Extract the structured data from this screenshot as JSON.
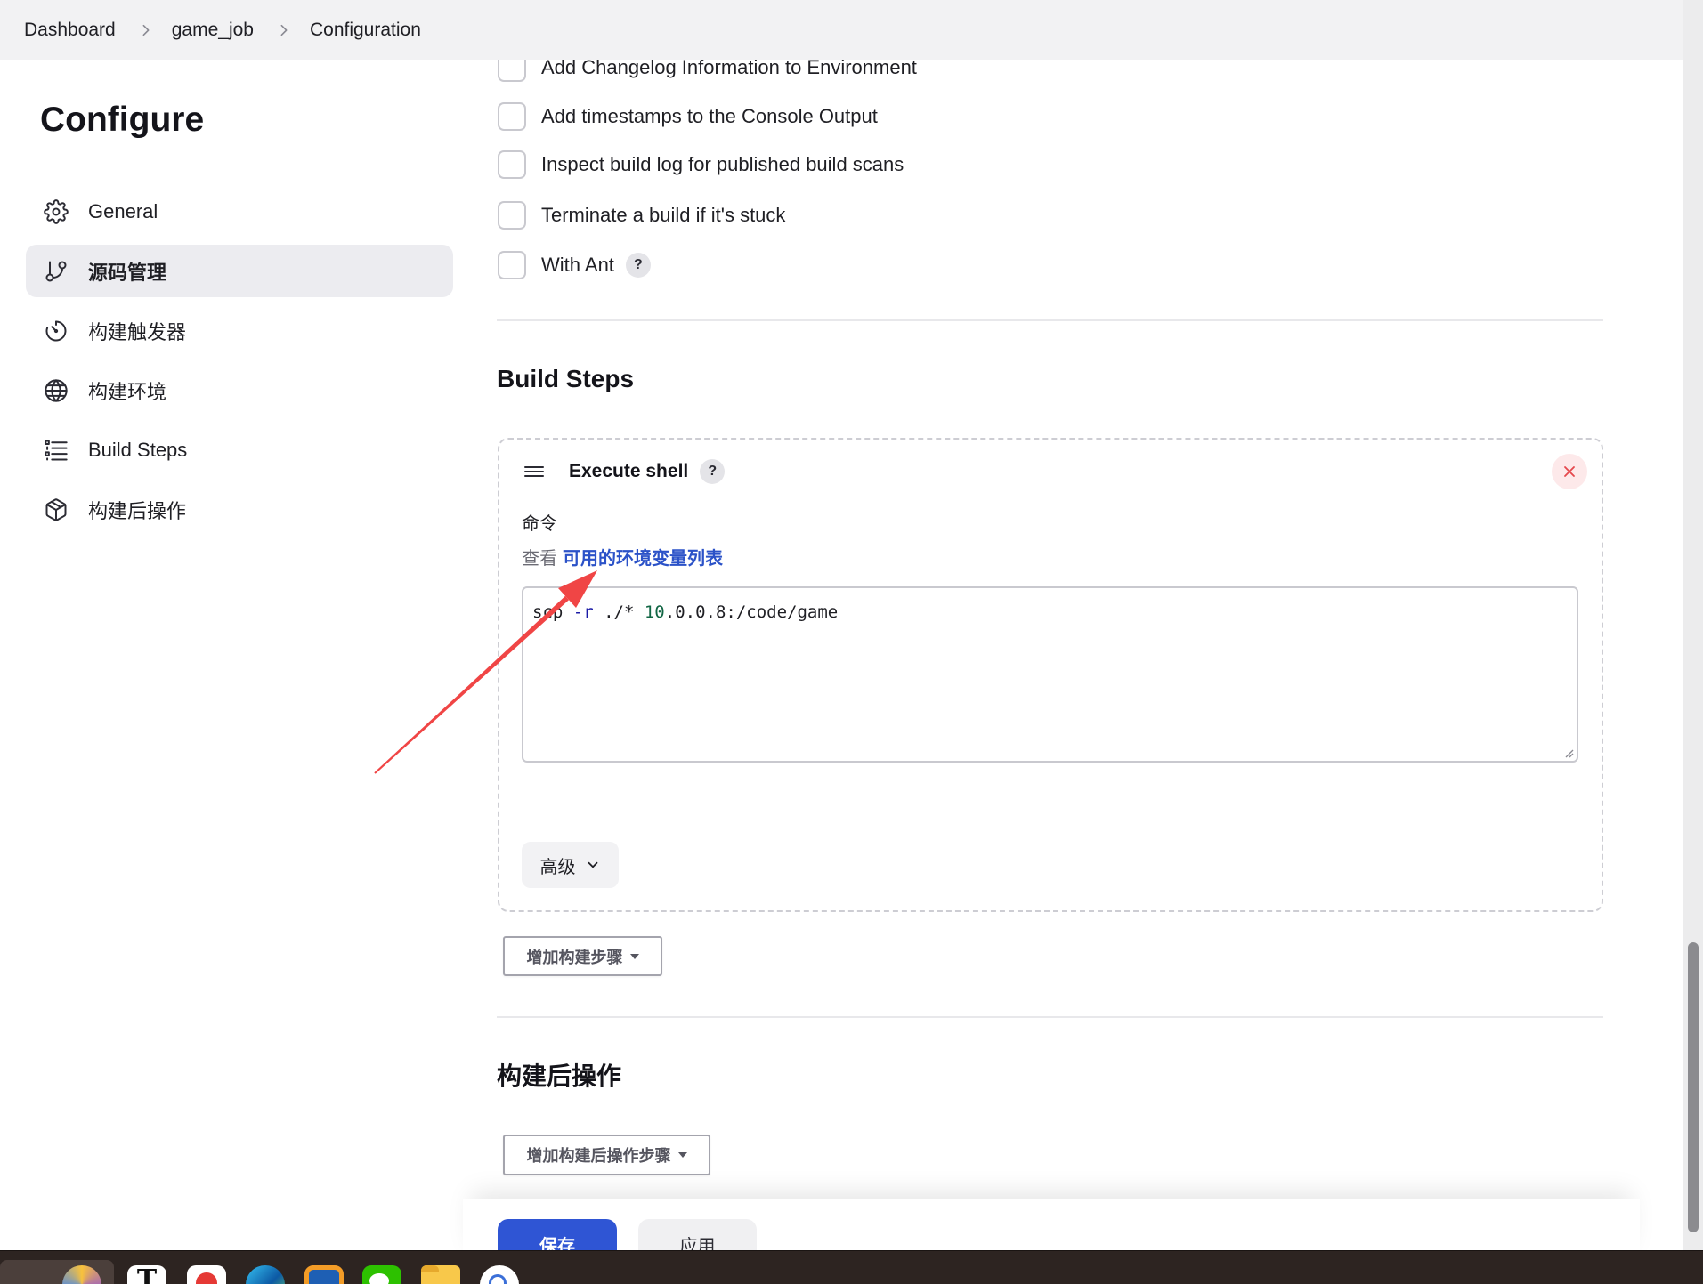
{
  "breadcrumb": {
    "items": [
      "Dashboard",
      "game_job",
      "Configuration"
    ]
  },
  "sidebar": {
    "title": "Configure",
    "items": [
      {
        "label": "General",
        "icon": "gear-icon",
        "active": false
      },
      {
        "label": "源码管理",
        "icon": "git-branch-icon",
        "active": true
      },
      {
        "label": "构建触发器",
        "icon": "timer-icon",
        "active": false
      },
      {
        "label": "构建环境",
        "icon": "globe-icon",
        "active": false
      },
      {
        "label": "Build Steps",
        "icon": "list-icon",
        "active": false
      },
      {
        "label": "构建后操作",
        "icon": "package-icon",
        "active": false
      }
    ]
  },
  "build_environment": {
    "options": [
      {
        "label": "Add Changelog Information to Environment",
        "checked": false
      },
      {
        "label": "Add timestamps to the Console Output",
        "checked": false
      },
      {
        "label": "Inspect build log for published build scans",
        "checked": false
      },
      {
        "label": "Terminate a build if it's stuck",
        "checked": false
      },
      {
        "label": "With Ant",
        "checked": false,
        "help": "?"
      }
    ]
  },
  "build_steps": {
    "heading": "Build Steps",
    "step": {
      "title": "Execute shell",
      "help": "?",
      "command_label": "命令",
      "env_hint_prefix": "查看",
      "env_link": "可用的环境变量列表",
      "command_tokens": [
        {
          "text": "scp ",
          "kind": "plain"
        },
        {
          "text": "-r",
          "kind": "attribute"
        },
        {
          "text": " ./* ",
          "kind": "plain"
        },
        {
          "text": "10",
          "kind": "number"
        },
        {
          "text": ".0.0.8:/code/game",
          "kind": "plain"
        }
      ],
      "advanced_label": "高级"
    },
    "add_step_label": "增加构建步骤"
  },
  "post_build": {
    "heading": "构建后操作",
    "add_label": "增加构建后操作步骤"
  },
  "footer": {
    "save_label": "保存",
    "apply_label": "应用"
  },
  "taskbar": {
    "icons": [
      "browser-icon",
      "text-editor-icon",
      "red-logo-app-icon",
      "edge-browser-icon",
      "vm-app-icon",
      "wechat-icon",
      "file-explorer-icon",
      "blue-ring-app-icon"
    ],
    "text_editor_glyph": "T"
  },
  "colors": {
    "accent": "#2f55d4",
    "link": "#2b52c8",
    "danger": "#e5484d",
    "annotation_arrow": "#f04545",
    "active_nav_bg": "#ececf0",
    "taskbar_bg": "#2d2421"
  }
}
